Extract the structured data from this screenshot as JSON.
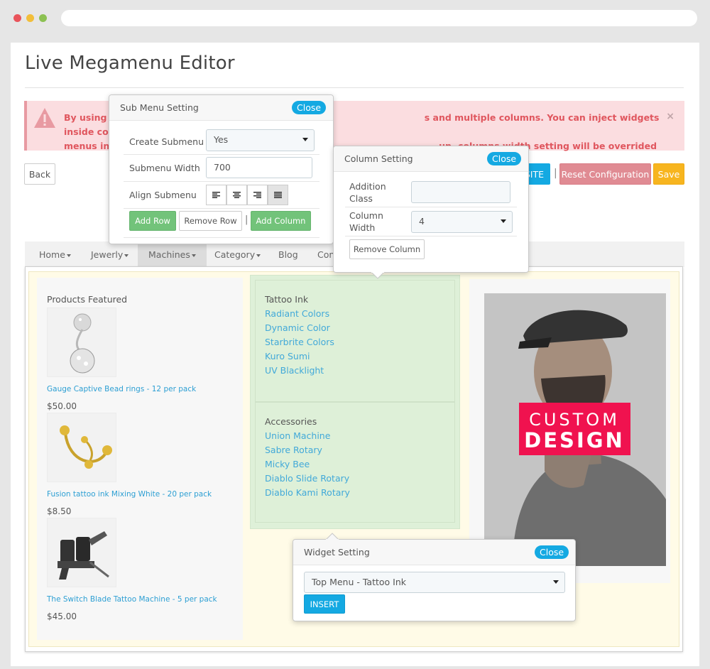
{
  "page": {
    "title": "Live Megamenu Editor"
  },
  "alert": {
    "text_left": "By using th",
    "text_left2": "menus in s",
    "text_right": "s and multiple columns. You can inject widgets inside columns or group sub",
    "text_right2": "up, columns width setting will be overrided",
    "close": "×"
  },
  "toolbar": {
    "back": "Back",
    "site": "SITE",
    "separator": "|",
    "reset": "Reset Configuration",
    "save": "Save"
  },
  "menu": {
    "items": [
      {
        "label": "Home"
      },
      {
        "label": "Jewerly"
      },
      {
        "label": "Machines"
      },
      {
        "label": "Category"
      },
      {
        "label": "Blog"
      },
      {
        "label": "Con"
      }
    ]
  },
  "products": {
    "heading": "Products Featured",
    "items": [
      {
        "name": "Gauge Captive Bead rings - 12 per pack",
        "price": "$50.00"
      },
      {
        "name": "Fusion tattoo ink Mixing White - 20 per pack",
        "price": "$8.50"
      },
      {
        "name": "The Switch Blade Tattoo Machine - 5 per pack",
        "price": "$45.00"
      }
    ]
  },
  "tattoo_ink": {
    "heading": "Tattoo Ink",
    "links": [
      "Radiant Colors",
      "Dynamic Color",
      "Starbrite Colors",
      "Kuro Sumi",
      "UV Blacklight"
    ]
  },
  "accessories": {
    "heading": "Accessories",
    "links": [
      "Union Machine",
      "Sabre Rotary",
      "Micky Bee",
      "Diablo Slide Rotary",
      "Diablo Kami Rotary"
    ]
  },
  "banner": {
    "line1": "CUSTOM",
    "line2": "DESIGN"
  },
  "submenu_setting": {
    "title": "Sub Menu Setting",
    "close": "Close",
    "create_label": "Create Submenu",
    "create_value": "Yes",
    "width_label": "Submenu Width",
    "width_value": "700",
    "align_label": "Align Submenu",
    "add_row": "Add Row",
    "remove_row": "Remove Row",
    "separator": "|",
    "add_column": "Add Column"
  },
  "column_setting": {
    "title": "Column Setting",
    "close": "Close",
    "class_label": "Addition Class",
    "class_value": "",
    "width_label": "Column Width",
    "width_value": "4",
    "remove_column": "Remove Column"
  },
  "widget_setting": {
    "title": "Widget Setting",
    "close": "Close",
    "widget_value": "Top Menu - Tattoo Ink",
    "insert": "INSERT"
  },
  "colors": {
    "accent": "#14a9e2",
    "link": "#42a9d9",
    "alert_text": "#e0565e",
    "alert_bg": "#fbdde0",
    "success": "#72c37a",
    "reset": "#e08b93",
    "save": "#f7b51f",
    "banner": "#f0124f"
  }
}
